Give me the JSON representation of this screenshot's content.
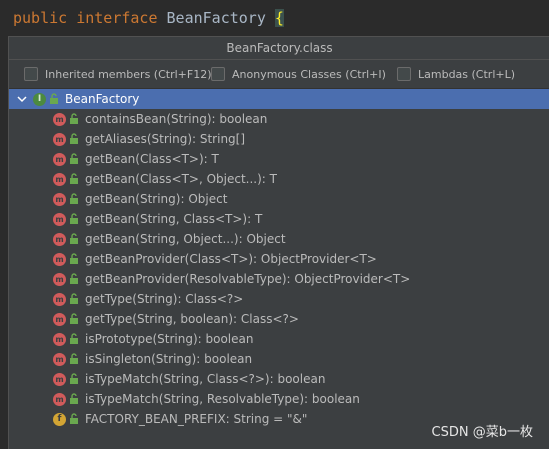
{
  "editor": {
    "keyword1": "public",
    "keyword2": "interface",
    "name": "BeanFactory",
    "brace": "{"
  },
  "popup": {
    "title": "BeanFactory.class",
    "options": [
      {
        "label": "Inherited members (Ctrl+F12)",
        "checked": false
      },
      {
        "label": "Anonymous Classes (Ctrl+I)",
        "checked": false
      },
      {
        "label": "Lambdas (Ctrl+L)",
        "checked": false
      }
    ],
    "root": {
      "label": "BeanFactory",
      "icon": "interface-icon",
      "expanded": true
    },
    "members": [
      {
        "label": "containsBean(String): boolean",
        "icon": "method-icon"
      },
      {
        "label": "getAliases(String): String[]",
        "icon": "method-icon"
      },
      {
        "label": "getBean(Class<T>): T",
        "icon": "method-icon"
      },
      {
        "label": "getBean(Class<T>, Object...): T",
        "icon": "method-icon"
      },
      {
        "label": "getBean(String): Object",
        "icon": "method-icon"
      },
      {
        "label": "getBean(String, Class<T>): T",
        "icon": "method-icon"
      },
      {
        "label": "getBean(String, Object...): Object",
        "icon": "method-icon"
      },
      {
        "label": "getBeanProvider(Class<T>): ObjectProvider<T>",
        "icon": "method-icon"
      },
      {
        "label": "getBeanProvider(ResolvableType): ObjectProvider<T>",
        "icon": "method-icon"
      },
      {
        "label": "getType(String): Class<?>",
        "icon": "method-icon"
      },
      {
        "label": "getType(String, boolean): Class<?>",
        "icon": "method-icon"
      },
      {
        "label": "isPrototype(String): boolean",
        "icon": "method-icon"
      },
      {
        "label": "isSingleton(String): boolean",
        "icon": "method-icon"
      },
      {
        "label": "isTypeMatch(String, Class<?>): boolean",
        "icon": "method-icon"
      },
      {
        "label": "isTypeMatch(String, ResolvableType): boolean",
        "icon": "method-icon"
      },
      {
        "label": "FACTORY_BEAN_PREFIX: String = \"&\"",
        "icon": "field-icon"
      }
    ]
  },
  "watermark": "CSDN @菜b一枚",
  "colors": {
    "selection": "#4b6eaf",
    "method": "#d15b5b",
    "field": "#d3a534",
    "interface": "#4c8a3f"
  }
}
